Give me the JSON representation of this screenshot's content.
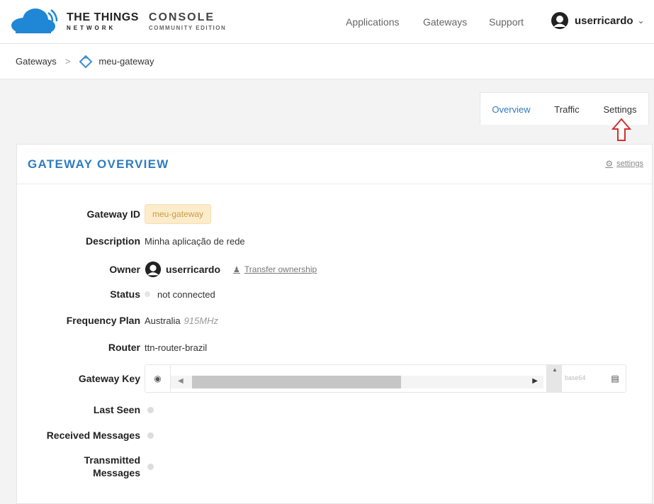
{
  "header": {
    "brand": "THE THINGS",
    "brand_sub": "NETWORK",
    "console": "CONSOLE",
    "edition": "COMMUNITY EDITION",
    "nav": [
      "Applications",
      "Gateways",
      "Support"
    ],
    "username": "userricardo"
  },
  "breadcrumb": {
    "root": "Gateways",
    "current": "meu-gateway"
  },
  "tabs": [
    "Overview",
    "Traffic",
    "Settings"
  ],
  "card": {
    "title": "GATEWAY OVERVIEW",
    "settings_link": "settings"
  },
  "fields": {
    "gateway_id_label": "Gateway ID",
    "gateway_id": "meu-gateway",
    "description_label": "Description",
    "description": "Minha aplicação de rede",
    "owner_label": "Owner",
    "owner": "userricardo",
    "transfer": "Transfer ownership",
    "status_label": "Status",
    "status": "not connected",
    "frequency_label": "Frequency Plan",
    "frequency": "Australia",
    "frequency_detail": "915MHz",
    "router_label": "Router",
    "router": "ttn-router-brazil",
    "key_label": "Gateway Key",
    "key_format": "base64",
    "last_seen_label": "Last Seen",
    "received_label": "Received Messages",
    "transmitted_label_1": "Transmitted",
    "transmitted_label_2": "Messages"
  },
  "colors": {
    "accent": "#2f7cc1",
    "badge_bg": "#fdeccb",
    "logo": "#1f87d6"
  },
  "icons": [
    "cloud-logo-icon",
    "user-avatar-icon",
    "chevron-down-icon",
    "gateway-icon",
    "gear-icon",
    "transfer-icon",
    "eye-icon",
    "copy-icon",
    "arrow-up-outline-icon"
  ]
}
